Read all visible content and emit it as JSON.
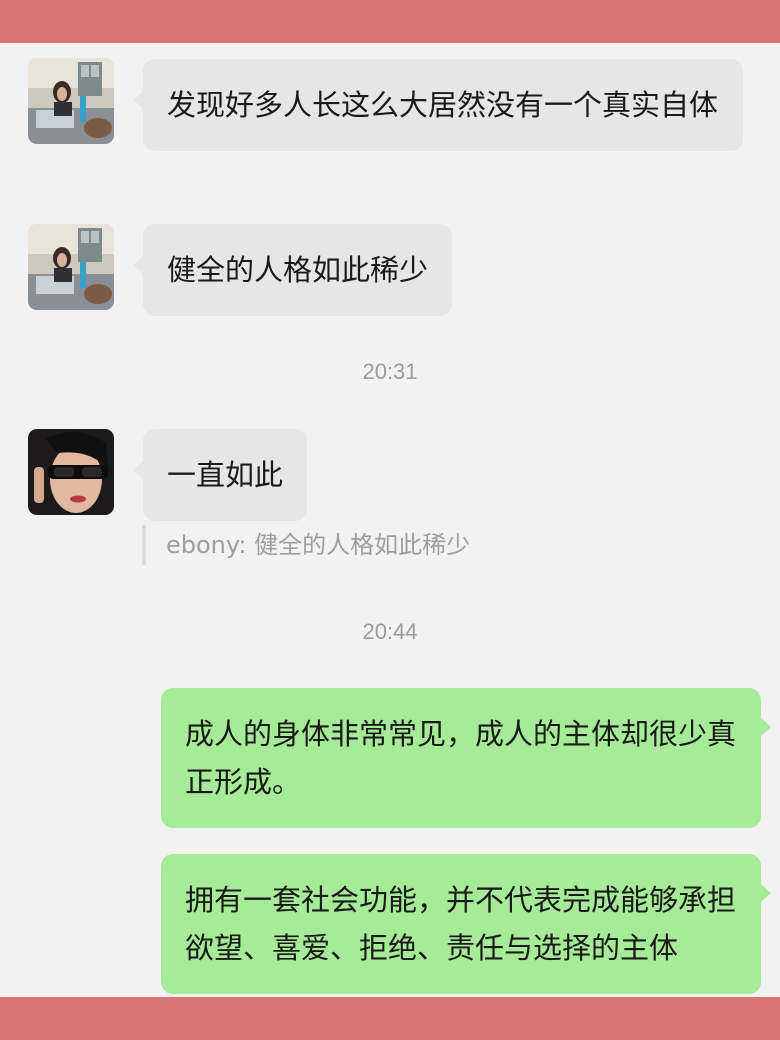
{
  "messages": [
    {
      "sender": "ebony",
      "direction": "incoming",
      "avatar": "avatar-woman-in-room",
      "text": "发现好多人长这么大居然没有一个真实自体"
    },
    {
      "sender": "ebony",
      "direction": "incoming",
      "avatar": "avatar-woman-in-room",
      "text": "健全的人格如此稀少"
    },
    {
      "time": "20:31"
    },
    {
      "direction": "incoming",
      "avatar": "avatar-woman-sunglasses",
      "text": "一直如此",
      "quote": "ebony: 健全的人格如此稀少"
    },
    {
      "time": "20:44"
    },
    {
      "direction": "outgoing",
      "text": "成人的身体非常常见，成人的主体却很少真正形成。"
    },
    {
      "direction": "outgoing",
      "text": "拥有一套社会功能，并不代表完成能够承担欲望、喜爱、拒绝、责任与选择的主体"
    }
  ],
  "colors": {
    "frame": "#d97474",
    "background": "#f2f2f2",
    "incoming_bubble": "#e6e6e6",
    "outgoing_bubble": "#a6eb97",
    "timestamp": "#9b9b9b"
  }
}
